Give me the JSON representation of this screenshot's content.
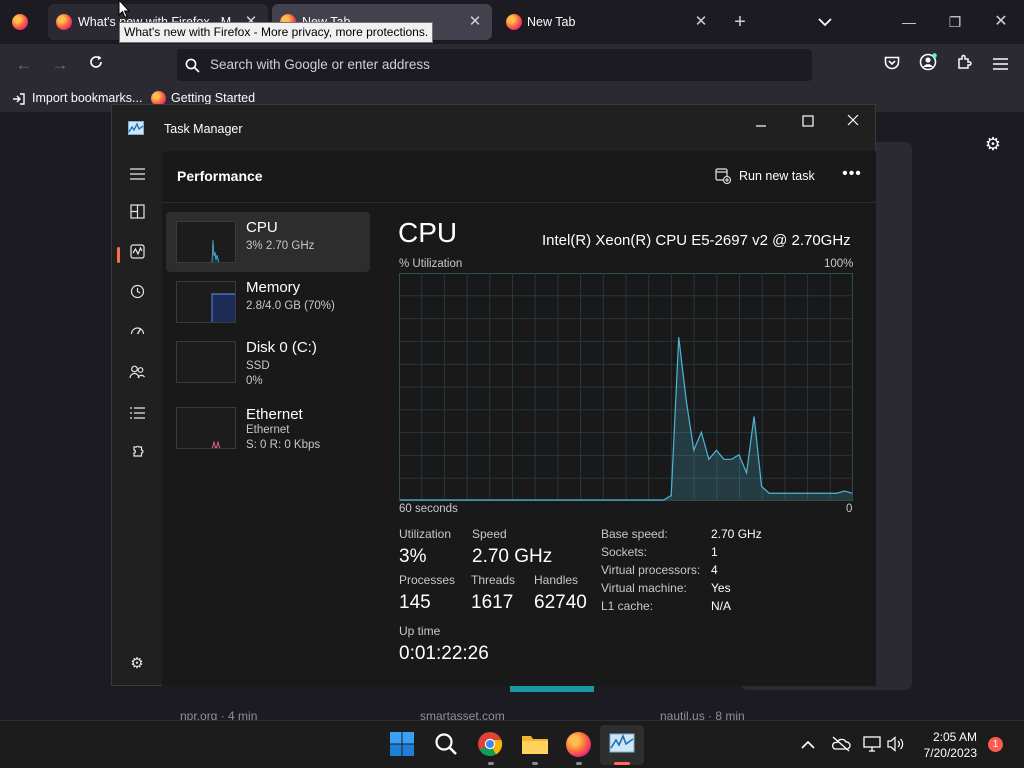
{
  "browser": {
    "tabs": [
      {
        "label": "What's new with Firefox - M",
        "active": false
      },
      {
        "label": "New Tab",
        "active": true
      },
      {
        "label": "New Tab",
        "active": false
      }
    ],
    "tooltip": "What's new with Firefox - More privacy, more protections.",
    "url_placeholder": "Search with Google or enter address",
    "bookmarks": [
      {
        "label": "Import bookmarks..."
      },
      {
        "label": "Getting Started"
      }
    ],
    "background_cards": [
      "npr.org · 4 min",
      "smartasset.com",
      "nautil.us · 8 min"
    ]
  },
  "task_manager": {
    "title": "Task Manager",
    "page_title": "Performance",
    "run_new_task": "Run new task",
    "resources": [
      {
        "name": "CPU",
        "line1": "3% 2.70 GHz",
        "line2": ""
      },
      {
        "name": "Memory",
        "line1": "2.8/4.0 GB (70%)",
        "line2": ""
      },
      {
        "name": "Disk 0 (C:)",
        "line1": "SSD",
        "line2": "0%"
      },
      {
        "name": "Ethernet",
        "line1": "Ethernet",
        "line2": "S: 0 R: 0 Kbps"
      }
    ],
    "detail": {
      "heading": "CPU",
      "model": "Intel(R) Xeon(R) CPU E5-2697 v2 @ 2.70GHz",
      "y_label": "% Utilization",
      "y_max_label": "100%",
      "x_left_label": "60 seconds",
      "x_right_label": "0",
      "stats": {
        "utilization_label": "Utilization",
        "utilization": "3%",
        "speed_label": "Speed",
        "speed": "2.70 GHz",
        "processes_label": "Processes",
        "processes": "145",
        "threads_label": "Threads",
        "threads": "1617",
        "handles_label": "Handles",
        "handles": "62740",
        "uptime_label": "Up time",
        "uptime": "0:01:22:26"
      },
      "specs": [
        {
          "k": "Base speed:",
          "v": "2.70 GHz"
        },
        {
          "k": "Sockets:",
          "v": "1"
        },
        {
          "k": "Virtual processors:",
          "v": "4"
        },
        {
          "k": "Virtual machine:",
          "v": "Yes"
        },
        {
          "k": "L1 cache:",
          "v": "N/A"
        }
      ]
    }
  },
  "chart_data": {
    "type": "area",
    "x": [
      60,
      59,
      58,
      57,
      56,
      55,
      54,
      53,
      52,
      51,
      50,
      49,
      48,
      47,
      46,
      45,
      44,
      43,
      42,
      41,
      40,
      39,
      38,
      37,
      36,
      35,
      34,
      33,
      32,
      31,
      30,
      29,
      28,
      27,
      26,
      25,
      24,
      23,
      22,
      21,
      20,
      19,
      18,
      17,
      16,
      15,
      14,
      13,
      12,
      11,
      10,
      9,
      8,
      7,
      6,
      5,
      4,
      3,
      2,
      1,
      0
    ],
    "series": [
      {
        "values": [
          0,
          0,
          0,
          0,
          0,
          0,
          0,
          0,
          0,
          0,
          0,
          0,
          0,
          0,
          0,
          0,
          0,
          0,
          0,
          0,
          0,
          0,
          0,
          0,
          0,
          0,
          0,
          0,
          0,
          0,
          0,
          0,
          0,
          0,
          0,
          0,
          2,
          72,
          44,
          22,
          30,
          18,
          22,
          18,
          18,
          20,
          12,
          37,
          6,
          3,
          3,
          3,
          3,
          3,
          3,
          3,
          3,
          3,
          3,
          4,
          3
        ]
      }
    ],
    "ylim": [
      0,
      100
    ],
    "color": "#4fb6d6"
  },
  "taskbar": {
    "time": "2:05 AM",
    "date": "7/20/2023",
    "badge": "1"
  }
}
